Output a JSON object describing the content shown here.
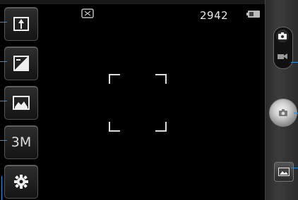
{
  "status": {
    "shot_count": "2942",
    "flash_icon": "flash-off-icon",
    "battery_icon": "battery-icon"
  },
  "left_controls": [
    {
      "id": "zoom",
      "icon": "zoom-icon"
    },
    {
      "id": "brightness",
      "icon": "brightness-icon"
    },
    {
      "id": "scene",
      "icon": "scene-mode-icon"
    },
    {
      "id": "resolution",
      "label": "3M"
    },
    {
      "id": "settings",
      "icon": "gear-icon"
    }
  ],
  "right_controls": {
    "mode": "camera",
    "shutter_icon": "shutter-icon",
    "gallery_icon": "gallery-icon"
  },
  "colors": {
    "callout": "#2a8fd8",
    "background": "#000000"
  }
}
